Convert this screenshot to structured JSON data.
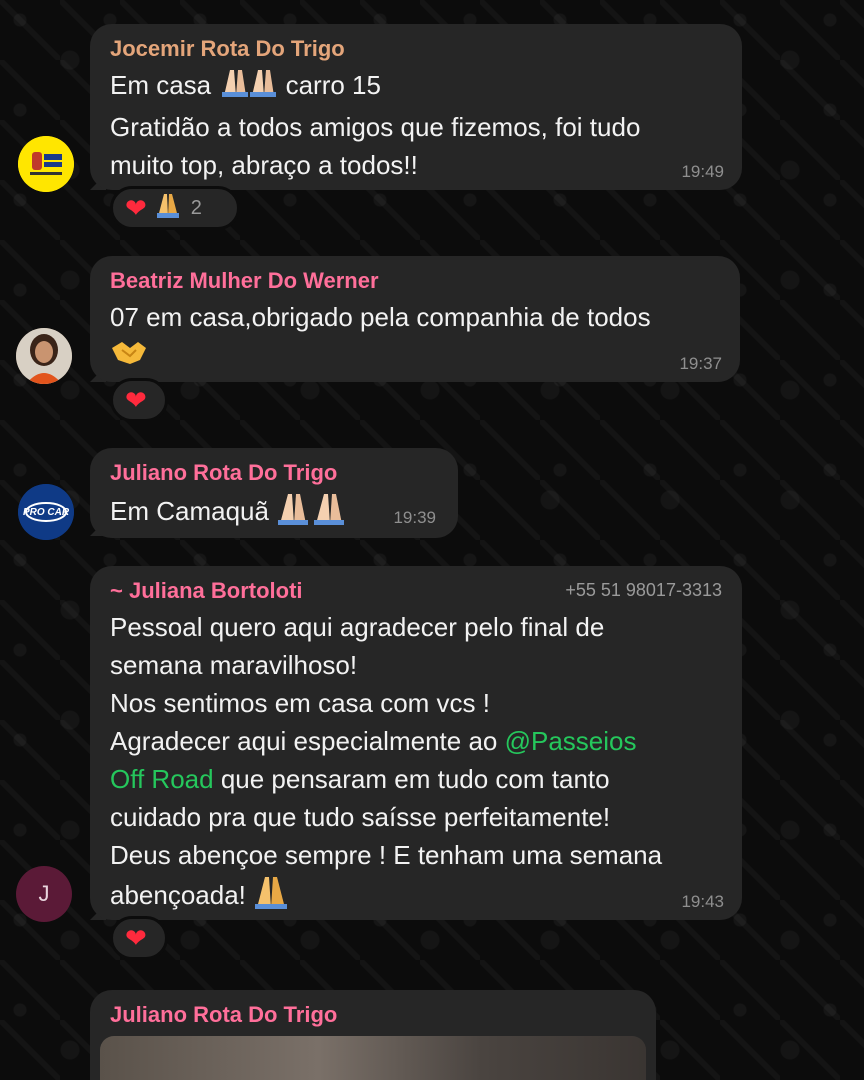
{
  "messages": [
    {
      "sender": "Jocemir Rota Do Trigo",
      "sender_color": "#e4a57a",
      "line1_before": "Em casa ",
      "line1_after": " carro 15",
      "line2": "Gratidão  a todos amigos que fizemos, foi  tudo",
      "line3": "muito  top, abraço a todos!!",
      "time": "19:49",
      "reaction_count": "2"
    },
    {
      "sender": "Beatriz Mulher Do Werner",
      "sender_color": "#ff6f9a",
      "line1": "07 em casa,obrigado pela companhia de todos",
      "time": "19:37"
    },
    {
      "sender": "Juliano Rota Do Trigo",
      "sender_color": "#ff6f9a",
      "line1": "Em Camaquã ",
      "time": "19:39",
      "avatar_text": "PRO CAR"
    },
    {
      "sender": "~ Juliana Bortoloti",
      "sender_color": "#ff6f9a",
      "phone": "+55 51 98017-3313",
      "line1": "Pessoal quero aqui agradecer pelo final de",
      "line2": "semana maravilhoso!",
      "line3": "Nos sentimos em casa com vcs !",
      "line4_before": "Agradecer aqui especialmente ao ",
      "mention_1": "@Passeios",
      "mention_2": "Off Road",
      "line5_after": "  que pensaram em tudo com tanto",
      "line6": "cuidado pra que tudo saísse perfeitamente!",
      "line7": "Deus abençoe sempre ! E tenham uma semana",
      "line8": "abençoada! ",
      "time": "19:43",
      "avatar_initial": "J"
    },
    {
      "sender": "Juliano Rota Do Trigo",
      "sender_color": "#ff6f9a"
    }
  ],
  "colors": {
    "bubble": "#262626",
    "background": "#0c0c0c",
    "mention": "#25c75c",
    "heart": "#ff2a3d"
  },
  "icons": [
    "praying-hands-icon",
    "handshake-icon",
    "heart-icon"
  ]
}
